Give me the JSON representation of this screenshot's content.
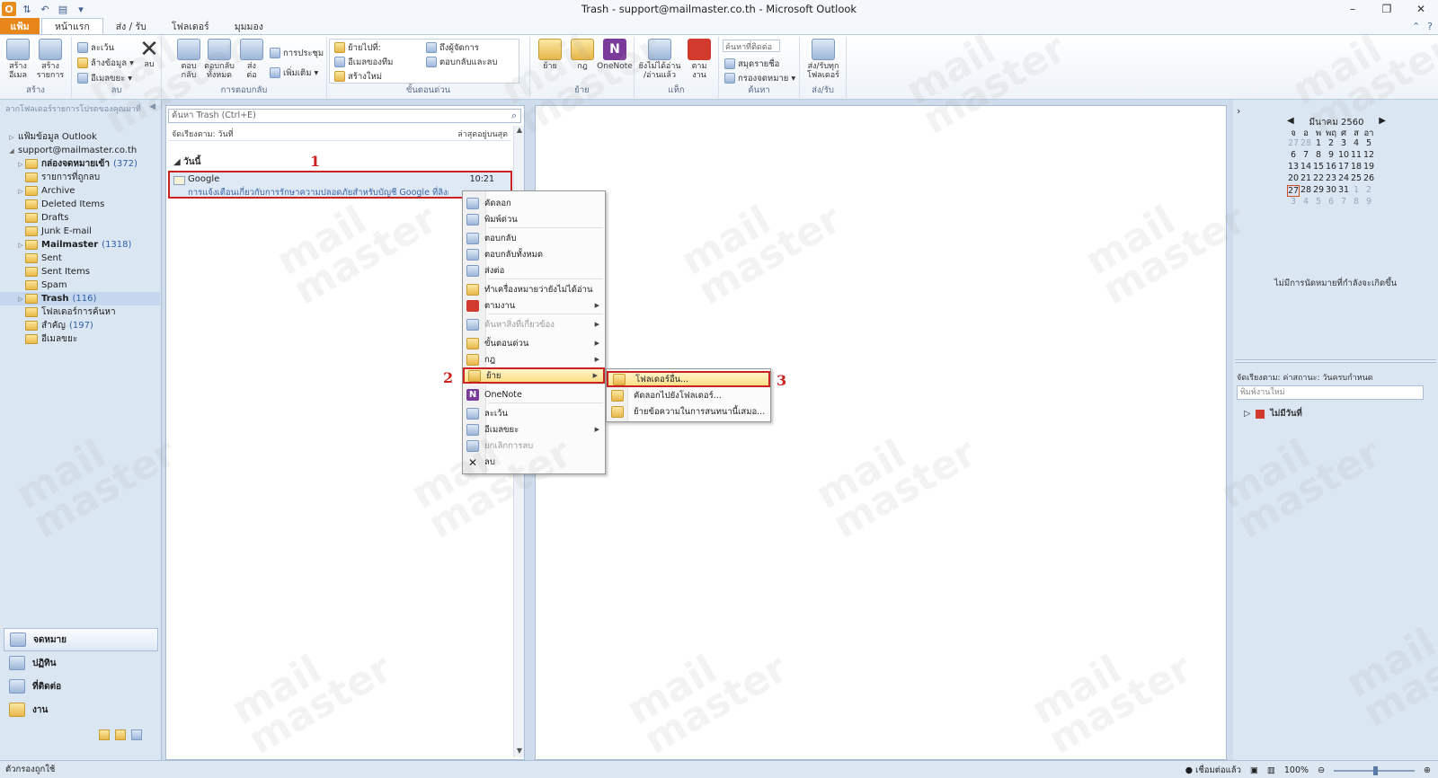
{
  "window": {
    "title": "Trash - support@mailmaster.co.th - Microsoft Outlook",
    "controls": [
      "–",
      "❐",
      "✕"
    ]
  },
  "tabs": [
    {
      "label": "แฟ้ม",
      "active": false,
      "file": true
    },
    {
      "label": "หน้าแรก",
      "active": true
    },
    {
      "label": "ส่ง / รับ",
      "active": false
    },
    {
      "label": "โฟลเดอร์",
      "active": false
    },
    {
      "label": "มุมมอง",
      "active": false
    }
  ],
  "ribbon": {
    "new": {
      "new_email": "สร้าง\nอีเมล",
      "new_items": "สร้าง\nรายการ",
      "group": "สร้าง"
    },
    "delete": {
      "ignore": "ละเว้น",
      "cleanup": "ล้างข้อมูล",
      "junk": "อีเมลขยะ",
      "delete": "ลบ",
      "group": "ลบ"
    },
    "respond": {
      "reply": "ตอบ\nกลับ",
      "reply_all": "ตอบกลับ\nทั้งหมด",
      "forward": "ส่ง\nต่อ",
      "meeting": "การประชุม",
      "more": "เพิ่มเติม",
      "group": "การตอบกลับ"
    },
    "quicksteps": {
      "move_to": "ย้ายไปที่:",
      "team_email": "อีเมลของทีม",
      "create_new": "สร้างใหม่",
      "to_manager": "ถึงผู้จัดการ",
      "reply_delete": "ตอบกลับและลบ",
      "group": "ขั้นตอนด่วน"
    },
    "move": {
      "move": "ย้าย",
      "rules": "กฎ",
      "onenote": "OneNote",
      "group": "ย้าย"
    },
    "tags": {
      "unread_read": "ยังไม่ได้อ่าน\n/อ่านแล้ว",
      "follow_up": "ตาม\nงาน",
      "group": "แท็ก"
    },
    "find": {
      "find_contact": "ค้นหาที่ติดต่อ",
      "address_book": "สมุดรายชื่อ",
      "filter_email": "กรองจดหมาย",
      "group": "ค้นหา"
    },
    "sendreceive": {
      "send_receive_all": "ส่ง/รับทุก\nโฟลเดอร์",
      "group": "ส่ง/รับ"
    }
  },
  "nav": {
    "drag_hint": "ลากโฟลเดอร์รายการโปรดของคุณมาที่",
    "folders": [
      {
        "label": "แฟ้มข้อมูล Outlook",
        "count": "",
        "indent": 0,
        "twisty": "▷",
        "bold": false,
        "icon": "none"
      },
      {
        "label": "support@mailmaster.co.th",
        "count": "",
        "indent": 0,
        "twisty": "◢",
        "bold": false,
        "icon": "none"
      },
      {
        "label": "กล่องจดหมายเข้า",
        "count": "(372)",
        "indent": 1,
        "twisty": "▷",
        "bold": true,
        "icon": "inbox"
      },
      {
        "label": "รายการที่ถูกลบ",
        "count": "",
        "indent": 1,
        "twisty": "",
        "bold": false,
        "icon": "deleted"
      },
      {
        "label": "Archive",
        "count": "",
        "indent": 1,
        "twisty": "▷",
        "bold": false,
        "icon": "folder"
      },
      {
        "label": "Deleted Items",
        "count": "",
        "indent": 1,
        "twisty": "",
        "bold": false,
        "icon": "folder"
      },
      {
        "label": "Drafts",
        "count": "",
        "indent": 1,
        "twisty": "",
        "bold": false,
        "icon": "folder"
      },
      {
        "label": "Junk E-mail",
        "count": "",
        "indent": 1,
        "twisty": "",
        "bold": false,
        "icon": "folder"
      },
      {
        "label": "Mailmaster",
        "count": "(1318)",
        "indent": 1,
        "twisty": "▷",
        "bold": true,
        "icon": "folder"
      },
      {
        "label": "Sent",
        "count": "",
        "indent": 1,
        "twisty": "",
        "bold": false,
        "icon": "folder"
      },
      {
        "label": "Sent Items",
        "count": "",
        "indent": 1,
        "twisty": "",
        "bold": false,
        "icon": "folder"
      },
      {
        "label": "Spam",
        "count": "",
        "indent": 1,
        "twisty": "",
        "bold": false,
        "icon": "folder"
      },
      {
        "label": "Trash",
        "count": "(116)",
        "indent": 1,
        "twisty": "▷",
        "bold": true,
        "icon": "folder",
        "selected": true
      },
      {
        "label": "โฟลเดอร์การค้นหา",
        "count": "",
        "indent": 1,
        "twisty": "",
        "bold": false,
        "icon": "search"
      },
      {
        "label": "สำคัญ",
        "count": "(197)",
        "indent": 1,
        "twisty": "",
        "bold": false,
        "icon": "folder"
      },
      {
        "label": "อีเมลขยะ",
        "count": "",
        "indent": 1,
        "twisty": "",
        "bold": false,
        "icon": "junk"
      }
    ],
    "modules": [
      {
        "label": "จดหมาย",
        "active": true
      },
      {
        "label": "ปฏิทิน",
        "active": false
      },
      {
        "label": "ที่ติดต่อ",
        "active": false
      },
      {
        "label": "งาน",
        "active": false
      }
    ]
  },
  "list": {
    "search_placeholder": "ค้นหา Trash (Ctrl+E)",
    "sort_by": "จัดเรียงตาม: วันที่",
    "sort_order": "ล่าสุดอยู่บนสุด",
    "group": "วันนี้",
    "message": {
      "sender": "Google",
      "time": "10:21",
      "preview": "การแจ้งเตือนเกี่ยวกับการรักษาความปลอดภัยสำหรับบัญชี Google ที่ลิงก์ของคุณ"
    }
  },
  "context_menu": {
    "items": [
      {
        "label": "คัดลอก",
        "submenu": false,
        "disabled": false,
        "icon": "copy"
      },
      {
        "label": "พิมพ์ด่วน",
        "submenu": false,
        "disabled": false,
        "icon": "print"
      },
      {
        "label": "ตอบกลับ",
        "submenu": false,
        "disabled": false,
        "icon": "reply"
      },
      {
        "label": "ตอบกลับทั้งหมด",
        "submenu": false,
        "disabled": false,
        "icon": "reply-all"
      },
      {
        "label": "ส่งต่อ",
        "submenu": false,
        "disabled": false,
        "icon": "forward"
      },
      {
        "label": "ทำเครื่องหมายว่ายังไม่ได้อ่าน",
        "submenu": false,
        "disabled": false,
        "icon": "mark-unread"
      },
      {
        "label": "ตามงาน",
        "submenu": true,
        "disabled": false,
        "icon": "flag"
      },
      {
        "label": "ค้นหาสิ่งที่เกี่ยวข้อง",
        "submenu": true,
        "disabled": true,
        "icon": "find-related"
      },
      {
        "label": "ขั้นตอนด่วน",
        "submenu": true,
        "disabled": false,
        "icon": "quick-steps"
      },
      {
        "label": "กฎ",
        "submenu": true,
        "disabled": false,
        "icon": "rules"
      },
      {
        "label": "ย้าย",
        "submenu": true,
        "disabled": false,
        "icon": "move",
        "highlighted": true
      },
      {
        "label": "OneNote",
        "submenu": false,
        "disabled": false,
        "icon": "onenote"
      },
      {
        "label": "ละเว้น",
        "submenu": false,
        "disabled": false,
        "icon": "ignore"
      },
      {
        "label": "อีเมลขยะ",
        "submenu": true,
        "disabled": false,
        "icon": "junk"
      },
      {
        "label": "ยกเลิกการลบ",
        "submenu": false,
        "disabled": true,
        "icon": "undelete"
      },
      {
        "label": "ลบ",
        "submenu": false,
        "disabled": false,
        "icon": "delete"
      }
    ],
    "submenu": [
      {
        "label": "โฟลเดอร์อื่น...",
        "highlighted": true
      },
      {
        "label": "คัดลอกไปยังโฟลเดอร์...",
        "highlighted": false
      },
      {
        "label": "ย้ายข้อความในการสนทนานี้เสมอ...",
        "highlighted": false
      }
    ]
  },
  "steps": [
    "1",
    "2",
    "3"
  ],
  "todo": {
    "month": "มีนาคม 2560",
    "weekdays": [
      "จ",
      "อ",
      "พ",
      "พฤ",
      "ศ",
      "ส",
      "อา"
    ],
    "weeks": [
      [
        "27",
        "28",
        "1",
        "2",
        "3",
        "4",
        "5"
      ],
      [
        "6",
        "7",
        "8",
        "9",
        "10",
        "11",
        "12"
      ],
      [
        "13",
        "14",
        "15",
        "16",
        "17",
        "18",
        "19"
      ],
      [
        "20",
        "21",
        "22",
        "23",
        "24",
        "25",
        "26"
      ],
      [
        "27",
        "28",
        "29",
        "30",
        "31",
        "1",
        "2"
      ],
      [
        "3",
        "4",
        "5",
        "6",
        "7",
        "8",
        "9"
      ]
    ],
    "no_appointments": "ไม่มีการนัดหมายที่กำลังจะเกิดขึ้น",
    "task_sort": "จัดเรียงตาม: ค่าสถานะ: วันครบกำหนด",
    "task_placeholder": "พิมพ์งานใหม่",
    "task_group": "ไม่มีวันที่"
  },
  "status": {
    "left": "ตัวกรองถูกใช้",
    "connection": "เชื่อมต่อแล้ว",
    "zoom": "100%"
  },
  "watermark": "mail\nmaster"
}
